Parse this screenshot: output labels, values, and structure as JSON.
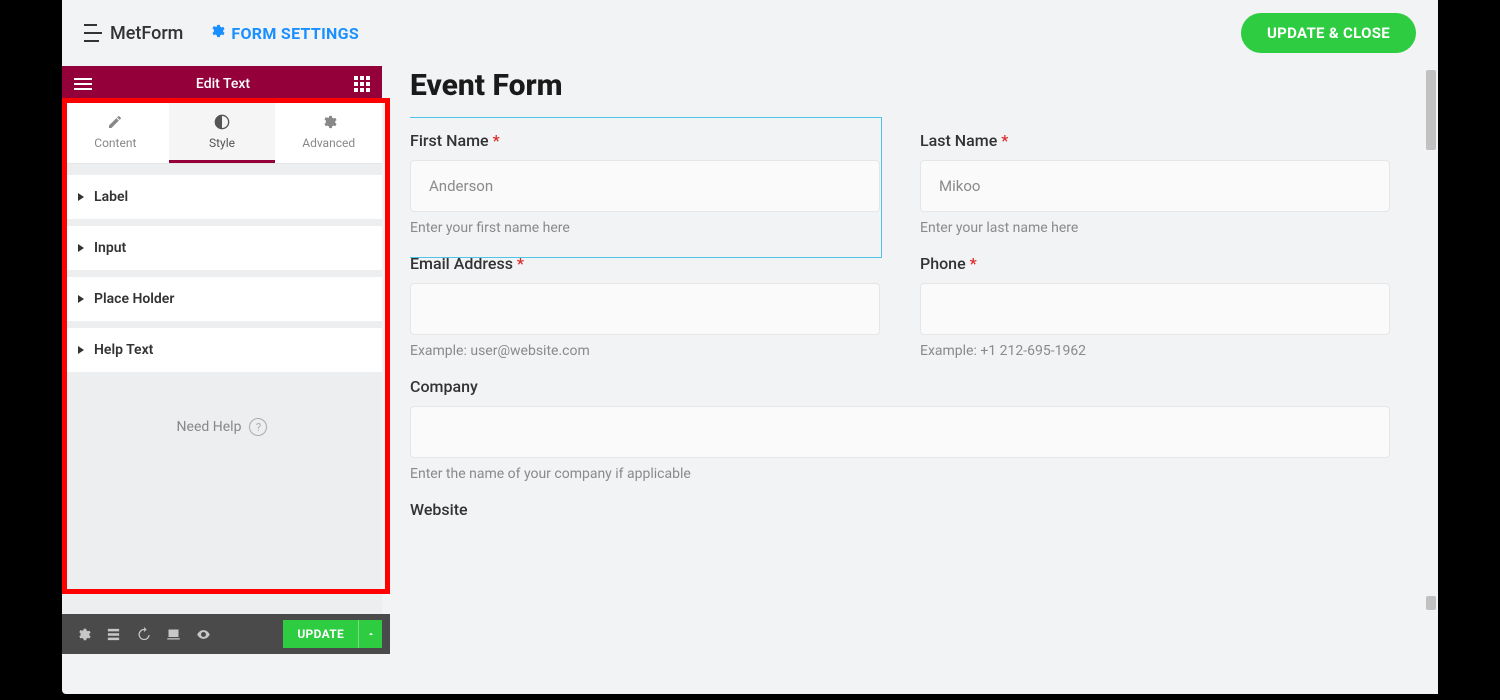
{
  "header": {
    "brand": "MetForm",
    "settings_label": "FORM SETTINGS",
    "update_close": "UPDATE & CLOSE"
  },
  "panel": {
    "title": "Edit Text",
    "tabs": {
      "content": "Content",
      "style": "Style",
      "advanced": "Advanced"
    },
    "sections": {
      "label": "Label",
      "input": "Input",
      "placeholder": "Place Holder",
      "helptext": "Help Text"
    },
    "need_help": "Need Help",
    "footer_update": "UPDATE"
  },
  "preview": {
    "title": "Event Form",
    "fields": {
      "first_name": {
        "label": "First Name",
        "placeholder": "Anderson",
        "help": "Enter your first name here"
      },
      "last_name": {
        "label": "Last Name",
        "placeholder": "Mikoo",
        "help": "Enter your last name here"
      },
      "email": {
        "label": "Email Address",
        "help": "Example: user@website.com"
      },
      "phone": {
        "label": "Phone",
        "help": "Example: +1 212-695-1962"
      },
      "company": {
        "label": "Company",
        "help": "Enter the name of your company if applicable"
      },
      "website": {
        "label": "Website"
      }
    }
  }
}
